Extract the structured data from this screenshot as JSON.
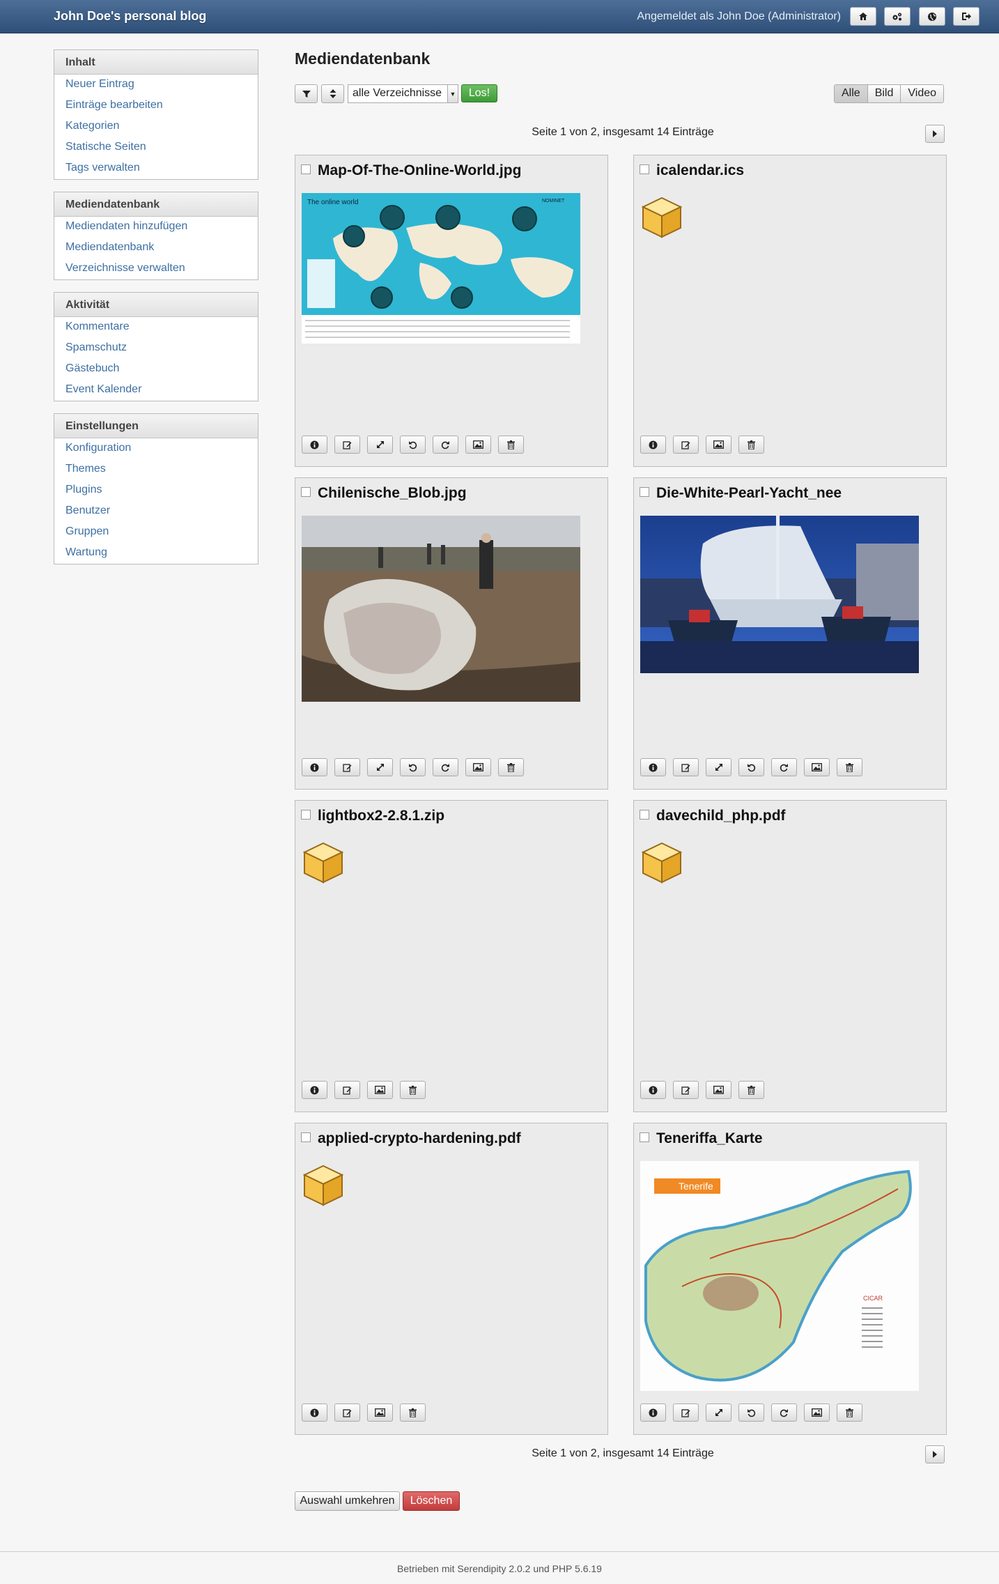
{
  "header": {
    "blog_title": "John Doe's personal blog",
    "logged_in": "Angemeldet als John Doe (Administrator)",
    "icons": [
      "home-icon",
      "cogs-icon",
      "globe-icon",
      "logout-icon"
    ]
  },
  "sidebar": {
    "sections": [
      {
        "title": "Inhalt",
        "items": [
          "Neuer Eintrag",
          "Einträge bearbeiten",
          "Kategorien",
          "Statische Seiten",
          "Tags verwalten"
        ]
      },
      {
        "title": "Mediendatenbank",
        "items": [
          "Mediendaten hinzufügen",
          "Mediendatenbank",
          "Verzeichnisse verwalten"
        ]
      },
      {
        "title": "Aktivität",
        "items": [
          "Kommentare",
          "Spamschutz",
          "Gästebuch",
          "Event Kalender"
        ]
      },
      {
        "title": "Einstellungen",
        "items": [
          "Konfiguration",
          "Themes",
          "Plugins",
          "Benutzer",
          "Gruppen",
          "Wartung"
        ]
      }
    ]
  },
  "main": {
    "title": "Mediendatenbank",
    "directory_select": "alle Verzeichnisse",
    "go_label": "Los!",
    "filters": [
      "Alle",
      "Bild",
      "Video"
    ],
    "pager": "Seite 1 von 2, insgesamt 14 Einträge",
    "files": [
      {
        "name": "Map-Of-The-Online-World.jpg",
        "kind": "image",
        "thumb": "map",
        "actions": [
          "info-icon",
          "edit-icon",
          "resize-icon",
          "rotate-left-icon",
          "rotate-right-icon",
          "image-icon",
          "trash-icon"
        ]
      },
      {
        "name": "icalendar.ics",
        "kind": "package",
        "actions": [
          "info-icon",
          "edit-icon",
          "image-icon",
          "trash-icon"
        ]
      },
      {
        "name": "Chilenische_Blob.jpg",
        "kind": "image",
        "thumb": "blob",
        "actions": [
          "info-icon",
          "edit-icon",
          "resize-icon",
          "rotate-left-icon",
          "rotate-right-icon",
          "image-icon",
          "trash-icon"
        ]
      },
      {
        "name": "Die-White-Pearl-Yacht_nee",
        "kind": "image",
        "thumb": "yacht",
        "actions": [
          "info-icon",
          "edit-icon",
          "resize-icon",
          "rotate-left-icon",
          "rotate-right-icon",
          "image-icon",
          "trash-icon"
        ]
      },
      {
        "name": "lightbox2-2.8.1.zip",
        "kind": "package",
        "actions": [
          "info-icon",
          "edit-icon",
          "image-icon",
          "trash-icon"
        ]
      },
      {
        "name": "davechild_php.pdf",
        "kind": "package",
        "actions": [
          "info-icon",
          "edit-icon",
          "image-icon",
          "trash-icon"
        ]
      },
      {
        "name": "applied-crypto-hardening.pdf",
        "kind": "package",
        "actions": [
          "info-icon",
          "edit-icon",
          "image-icon",
          "trash-icon"
        ]
      },
      {
        "name": "Teneriffa_Karte",
        "kind": "image",
        "thumb": "tenerife",
        "actions": [
          "info-icon",
          "edit-icon",
          "resize-icon",
          "rotate-left-icon",
          "rotate-right-icon",
          "image-icon",
          "trash-icon"
        ]
      }
    ],
    "thumb_text": {
      "map_title": "The online world",
      "map_brand": "NOMINET",
      "tenerife_title": "Tenerife",
      "tenerife_brand": "CICAR"
    },
    "invert_label": "Auswahl umkehren",
    "delete_label": "Löschen"
  },
  "footer": {
    "text": "Betrieben mit Serendipity 2.0.2 und PHP 5.6.19"
  }
}
